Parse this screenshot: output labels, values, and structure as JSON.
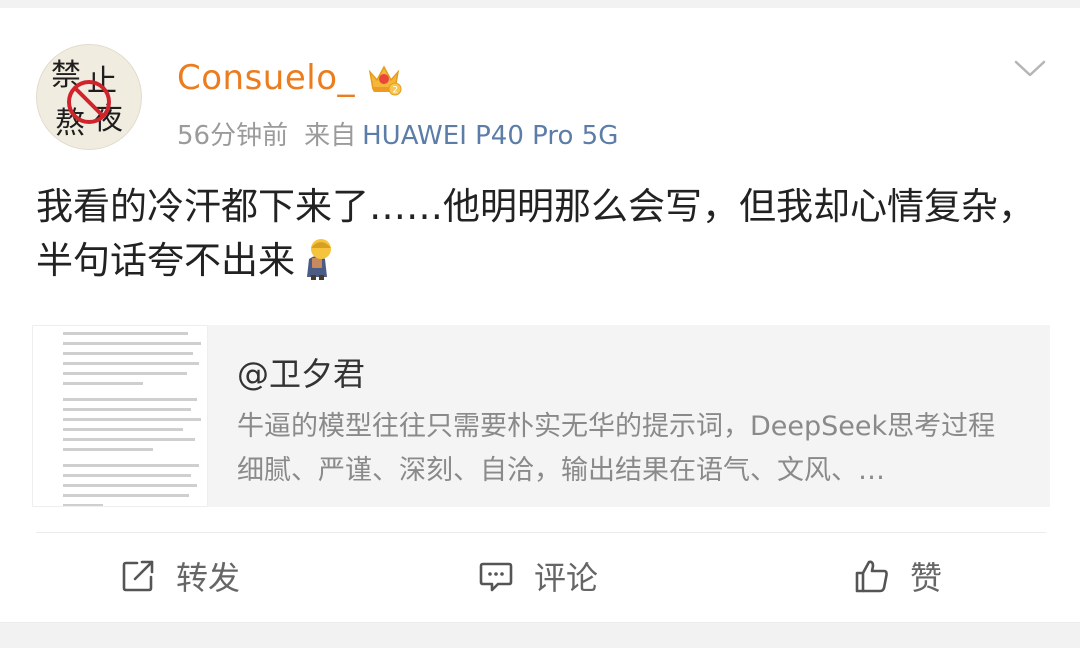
{
  "post": {
    "username": "Consuelo_",
    "time_ago": "56分钟前",
    "from_label": "来自",
    "device": "HUAWEI P40 Pro 5G",
    "text": "我看的冷汗都下来了……他明明那么会写，但我却心情复杂，半句话夸不出来",
    "emoji": "person-bowing-emoji"
  },
  "avatar": {
    "chars": [
      "禁",
      "止",
      "熬",
      "夜"
    ]
  },
  "quote": {
    "author": "@卫夕君",
    "excerpt": "牛逼的模型往往只需要朴实无华的提示词，DeepSeek思考过程细腻、严谨、深刻、自洽，输出结果在语气、文风、…"
  },
  "actions": {
    "repost": "转发",
    "comment": "评论",
    "like": "赞"
  },
  "icons": {
    "menu": "chevron-down-icon",
    "badge": "crown-badge-icon",
    "repost": "repost-icon",
    "comment": "comment-icon",
    "like": "thumbs-up-icon"
  }
}
